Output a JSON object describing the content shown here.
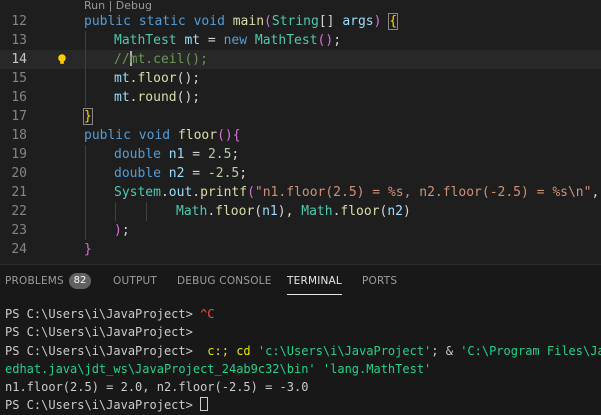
{
  "editor": {
    "codelens": {
      "run": "Run",
      "sep": " | ",
      "debug": "Debug"
    },
    "lines": [
      {
        "n": "12"
      },
      {
        "n": "13"
      },
      {
        "n": "14"
      },
      {
        "n": "15"
      },
      {
        "n": "16"
      },
      {
        "n": "17"
      },
      {
        "n": "18"
      },
      {
        "n": "19"
      },
      {
        "n": "20"
      },
      {
        "n": "21"
      },
      {
        "n": "22"
      },
      {
        "n": "23"
      },
      {
        "n": "24"
      }
    ],
    "code": {
      "l12": {
        "public": "public",
        "static": "static",
        "void": "void",
        "main": "main",
        "String": "String",
        "arr": "[] ",
        "args": "args",
        "lp": "(",
        "rp": ") ",
        "lb": "{"
      },
      "l13": {
        "type": "MathTest",
        "var": "mt",
        "eq": " = ",
        "new": "new",
        "ctor": "MathTest",
        "paren": "()",
        "semi": ";"
      },
      "l14": {
        "comment1": "//",
        "comment2": "mt.ceil();"
      },
      "l15": {
        "obj": "mt",
        "dot": ".",
        "fn": "floor",
        "rest": "();"
      },
      "l16": {
        "obj": "mt",
        "dot": ".",
        "fn": "round",
        "rest": "();"
      },
      "l17": {
        "rb": "}"
      },
      "l18": {
        "public": "public",
        "void": "void",
        "fn": "floor",
        "paren": "()",
        "lb": "{"
      },
      "l19": {
        "type": "double",
        "var": "n1",
        "eq": " = ",
        "num": "2.5",
        "semi": ";"
      },
      "l20": {
        "type": "double",
        "var": "n2",
        "eq": " = -",
        "num": "2.5",
        "semi": ";"
      },
      "l21": {
        "cls": "System",
        "dot1": ".",
        "field": "out",
        "dot2": ".",
        "fn": "printf",
        "lp": "(",
        "str": "\"n1.floor(2.5) = %s, n2.floor(-2.5) = %s\\n\"",
        "comma": ","
      },
      "l22": {
        "cls1": "Math",
        "dot1": ".",
        "fn1": "floor",
        "arg1": "n1",
        "sep": "), ",
        "cls2": "Math",
        "dot2": ".",
        "fn2": "floor",
        "arg2": "n2",
        "end": ")"
      },
      "l23": {
        "rp": ")",
        "semi": ";"
      },
      "l24": {
        "rb": "}"
      }
    }
  },
  "panel": {
    "tabs": [
      {
        "label": "PROBLEMS"
      },
      {
        "label": "OUTPUT"
      },
      {
        "label": "DEBUG CONSOLE"
      },
      {
        "label": "TERMINAL"
      },
      {
        "label": "PORTS"
      }
    ],
    "problems_count": "82",
    "terminal": {
      "prompt": "PS C:\\Users\\i\\JavaProject> ",
      "l1_ctrlc": "^C",
      "l3_pre": " c:; ",
      "l3_cd": "cd",
      "l3_path": "'c:\\Users\\i\\JavaProject'",
      "l3_mid": "; & ",
      "l3_java": "'C:\\Program Files\\Java",
      "l4_rest": "edhat.java\\jdt_ws\\JavaProject_24ab9c32\\bin'",
      "l4_sp": " ",
      "l4_class": "'lang.MathTest'",
      "l5_output": "n1.floor(2.5) = 2.0, n2.floor(-2.5) = -3.0"
    }
  },
  "colors": {
    "keyword": "#569cd6",
    "type": "#4ec9b0",
    "function": "#dcdcaa",
    "variable": "#9cdcfe",
    "number": "#b5cea8",
    "string": "#ce9178",
    "comment": "#6a9955",
    "bracket": "#ffd700",
    "background": "#1e1e1e",
    "panel_background": "#181818"
  }
}
